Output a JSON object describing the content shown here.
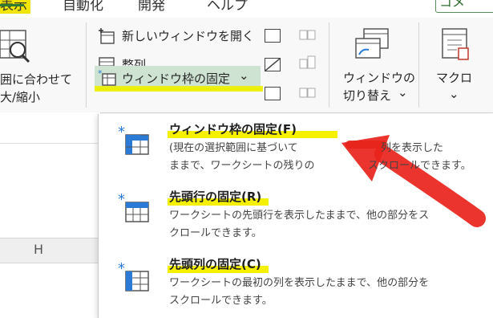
{
  "tabs": {
    "view": "表示",
    "automate": "自動化",
    "developer": "開発",
    "help": "ヘルプ",
    "share": "コメ"
  },
  "ribbon": {
    "zoom_selection_line1": "囲に合わせて",
    "zoom_selection_line2": "大/縮小",
    "new_window": "新しいウィンドウを開く",
    "arrange_all": "整列",
    "freeze_panes": "ウィンドウ枠の固定",
    "freeze_panes_caret": "⌄",
    "switch_windows_line1": "ウィンドウの",
    "switch_windows_line2": "切り替え",
    "switch_caret": "⌄",
    "macros": "マクロ",
    "macros_caret": "⌄"
  },
  "sheet": {
    "column_header": "H"
  },
  "menu": {
    "items": [
      {
        "title": "ウィンドウ枠の固定(F)",
        "desc_line1": "(現在の選択範囲に基づいて",
        "desc_line1b": "列を表示した",
        "desc_line2": "ままで、ワークシートの残りの",
        "desc_line2b": "スクロールできます。"
      },
      {
        "title": "先頭行の固定(R)",
        "desc_line1": "ワークシートの先頭行を表示したままで、他の部分をス",
        "desc_line2": "クロールできます。"
      },
      {
        "title": "先頭列の固定(C)",
        "desc_line1": "ワークシートの最初の列を表示したままで、他の部分を",
        "desc_line2": "スクロールできます。"
      }
    ]
  },
  "colors": {
    "highlight": "#f5f000",
    "freeze_button_bg": "#cfe3d2",
    "annotation_arrow": "#e8231b",
    "icon_blue": "#2b7bd6"
  }
}
